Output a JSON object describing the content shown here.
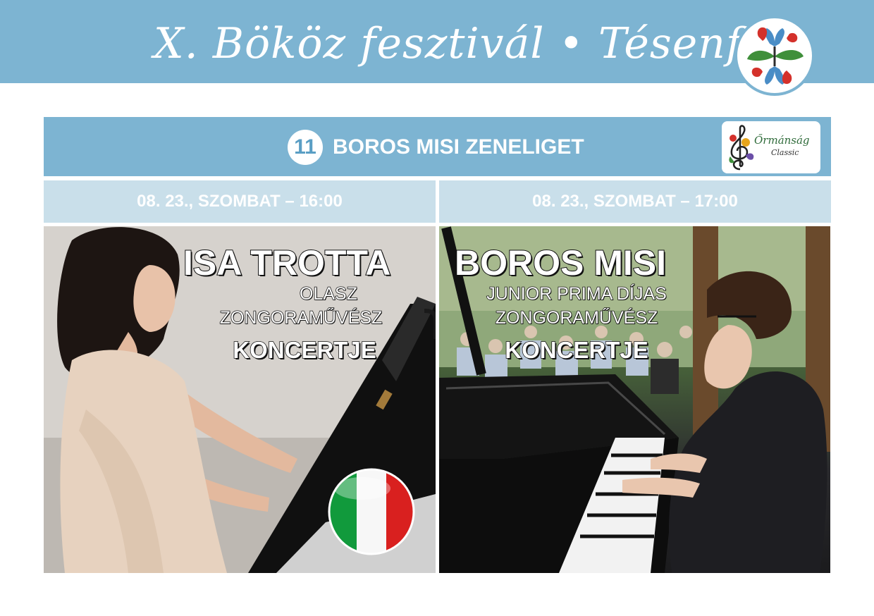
{
  "header": {
    "festival_title": "X. Bököz fesztivál • Tésenfa",
    "festival_logo_icon": "tulip-flower-icon",
    "bg_color": "#7db4d2"
  },
  "venue": {
    "number": "11",
    "name": "BOROS MISI ZENELIGET",
    "partner_logo": {
      "text": "Őrmánság",
      "subtext": "Classic",
      "icon": "treble-clef-flower-icon"
    }
  },
  "events": [
    {
      "datetime": "08. 23., SZOMBAT – 16:00",
      "artist": "ISA TROTTA",
      "subtitle_lines": [
        "OLASZ",
        "ZONGORAMŰVÉSZ"
      ],
      "concert_label": "KONCERTJE",
      "badge_icon": "italian-flag-icon"
    },
    {
      "datetime": "08. 23., SZOMBAT – 17:00",
      "artist": "BOROS MISI",
      "subtitle_lines": [
        "JUNIOR PRIMA DÍJAS",
        "ZONGORAMŰVÉSZ"
      ],
      "concert_label": "KONCERTJE"
    }
  ],
  "colors": {
    "accent_blue": "#7db4d2",
    "light_blue": "#c9dfea",
    "flag_green": "#119a3c",
    "flag_red": "#d9201f"
  }
}
